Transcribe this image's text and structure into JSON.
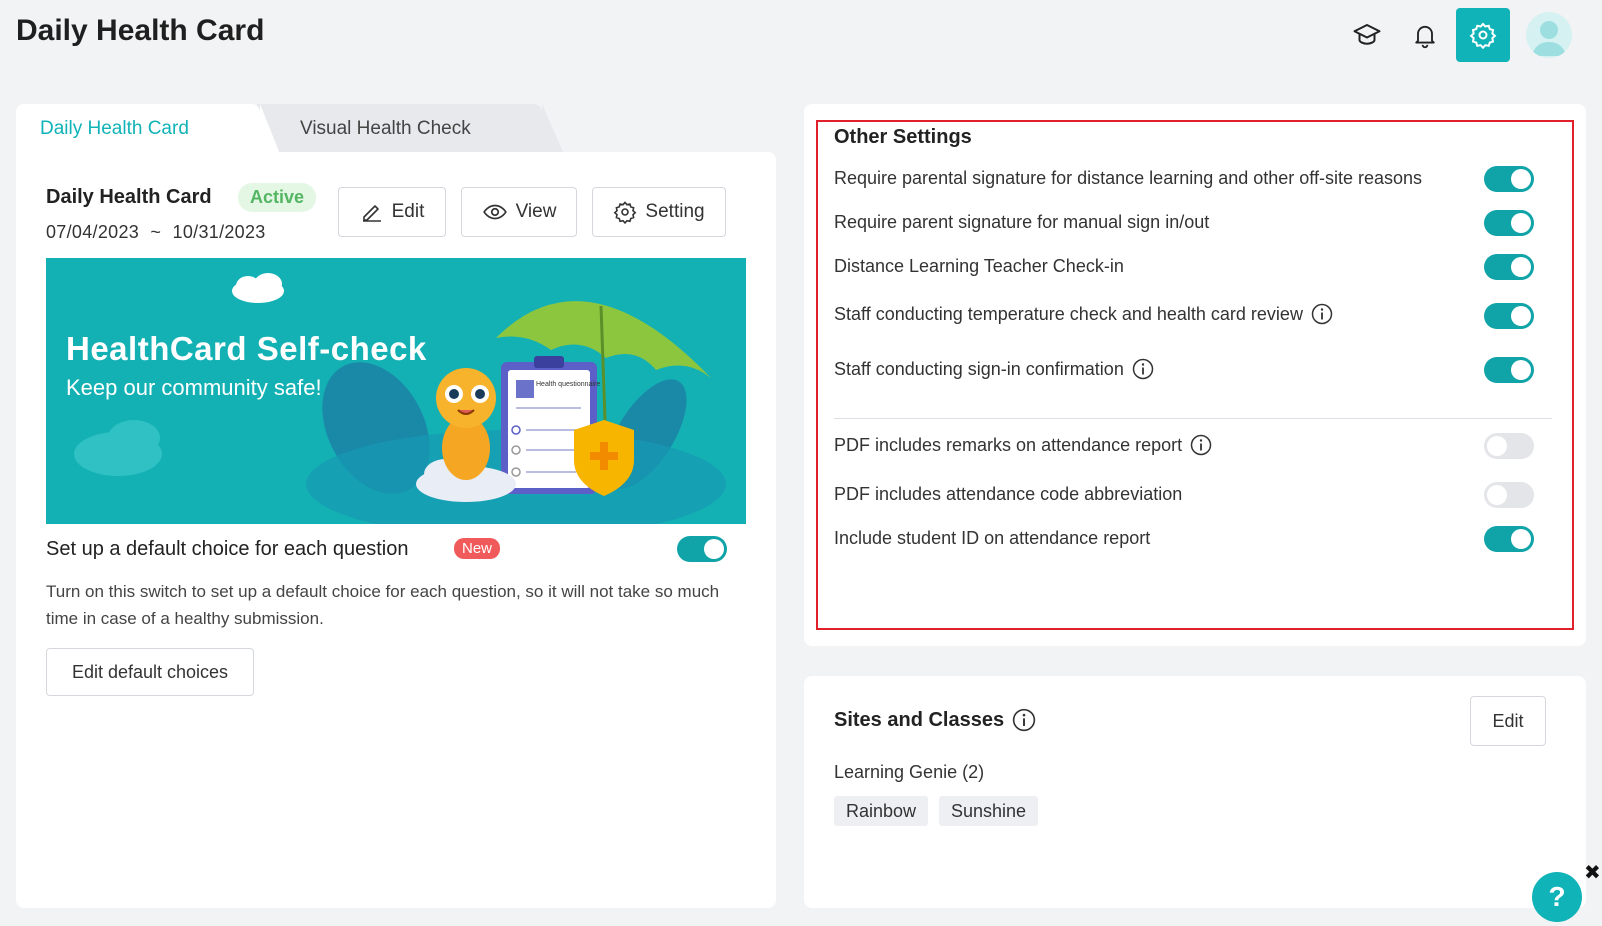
{
  "header": {
    "title": "Daily Health Card",
    "icons": [
      "graduation-cap-icon",
      "bell-icon",
      "gear-icon",
      "user-avatar"
    ]
  },
  "tabs": [
    {
      "label": "Daily Health Card",
      "active": true
    },
    {
      "label": "Visual Health Check",
      "active": false
    }
  ],
  "card": {
    "title": "Daily Health Card",
    "status": "Active",
    "date_start": "07/04/2023",
    "date_sep": "~",
    "date_end": "10/31/2023",
    "edit_label": "Edit",
    "view_label": "View",
    "setting_label": "Setting"
  },
  "banner": {
    "title": "HealthCard Self-check",
    "subtitle": "Keep our community safe!",
    "clipboard_text": "Health questionnaire"
  },
  "default_choice": {
    "title": "Set up a default choice for each question",
    "badge": "New",
    "enabled": true,
    "description": "Turn on this switch to set up a default choice for each question, so it will not take so much time in case of a healthy submission.",
    "button_label": "Edit default choices"
  },
  "other_settings": {
    "title": "Other Settings",
    "items": [
      {
        "label": "Require parental signature for distance learning and other off-site reasons",
        "enabled": true,
        "info": false
      },
      {
        "label": "Require parent signature for manual sign in/out",
        "enabled": true,
        "info": false
      },
      {
        "label": "Distance Learning Teacher Check-in",
        "enabled": true,
        "info": false
      },
      {
        "label": "Staff conducting temperature check and health card review",
        "enabled": true,
        "info": true
      },
      {
        "label": "Staff conducting sign-in confirmation",
        "enabled": true,
        "info": true
      },
      {
        "label": "PDF includes remarks on attendance report",
        "enabled": false,
        "info": true
      },
      {
        "label": "PDF includes attendance code abbreviation",
        "enabled": false,
        "info": false
      },
      {
        "label": "Include student ID on attendance report",
        "enabled": true,
        "info": false
      }
    ]
  },
  "sites": {
    "title": "Sites and Classes",
    "edit_label": "Edit",
    "site_name": "Learning Genie (2)",
    "classes": [
      "Rainbow",
      "Sunshine"
    ]
  },
  "help": {
    "label": "?",
    "close": "✖"
  },
  "colors": {
    "accent": "#10b3b7",
    "toggle_on": "#10a4a8",
    "highlight": "#e0202a",
    "active_badge": "#54b563",
    "new_badge": "#f05a5a"
  }
}
